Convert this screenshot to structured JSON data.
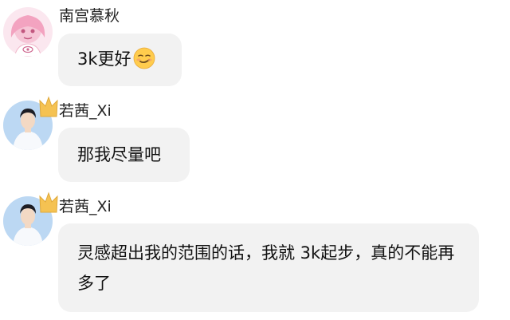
{
  "messages": [
    {
      "sender": "南宫慕秋",
      "text": "3k更好",
      "emoji": "smirking-face-emoji",
      "avatar": "anime-girl-avatar"
    },
    {
      "sender": "若茜_Xi",
      "text": "那我尽量吧",
      "avatar": "boy-photo-avatar",
      "badge": "crown-badge-icon"
    },
    {
      "sender": "若茜_Xi",
      "text": "灵感超出我的范围的话，我就 3k起步，真的不能再多了",
      "avatar": "boy-photo-avatar",
      "badge": "crown-badge-icon"
    }
  ],
  "colors": {
    "bubble": "#f2f2f2",
    "text": "#111111",
    "name": "#222222",
    "crown": "#f5c252"
  }
}
